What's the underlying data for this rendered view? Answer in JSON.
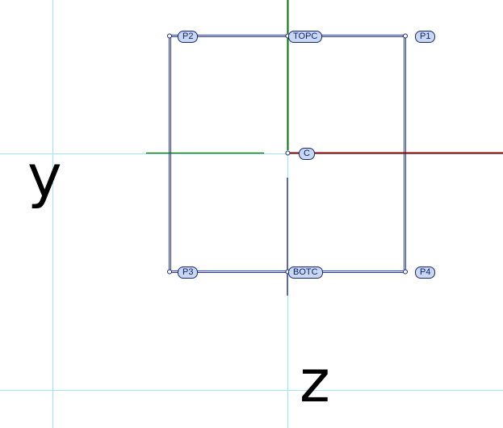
{
  "axes": {
    "horizontal": "y",
    "vertical": "z"
  },
  "points": {
    "p1": "P1",
    "p2": "P2",
    "p3": "P3",
    "p4": "P4",
    "topc": "TOPC",
    "botc": "BOTC",
    "center": "C"
  },
  "colors": {
    "guide": "#9fe8f0",
    "outline": "#2233cc",
    "axis_x": "#8b0000",
    "axis_y": "#007000",
    "label_fill": "#c8d8f2",
    "label_border": "#1a2a6e"
  }
}
